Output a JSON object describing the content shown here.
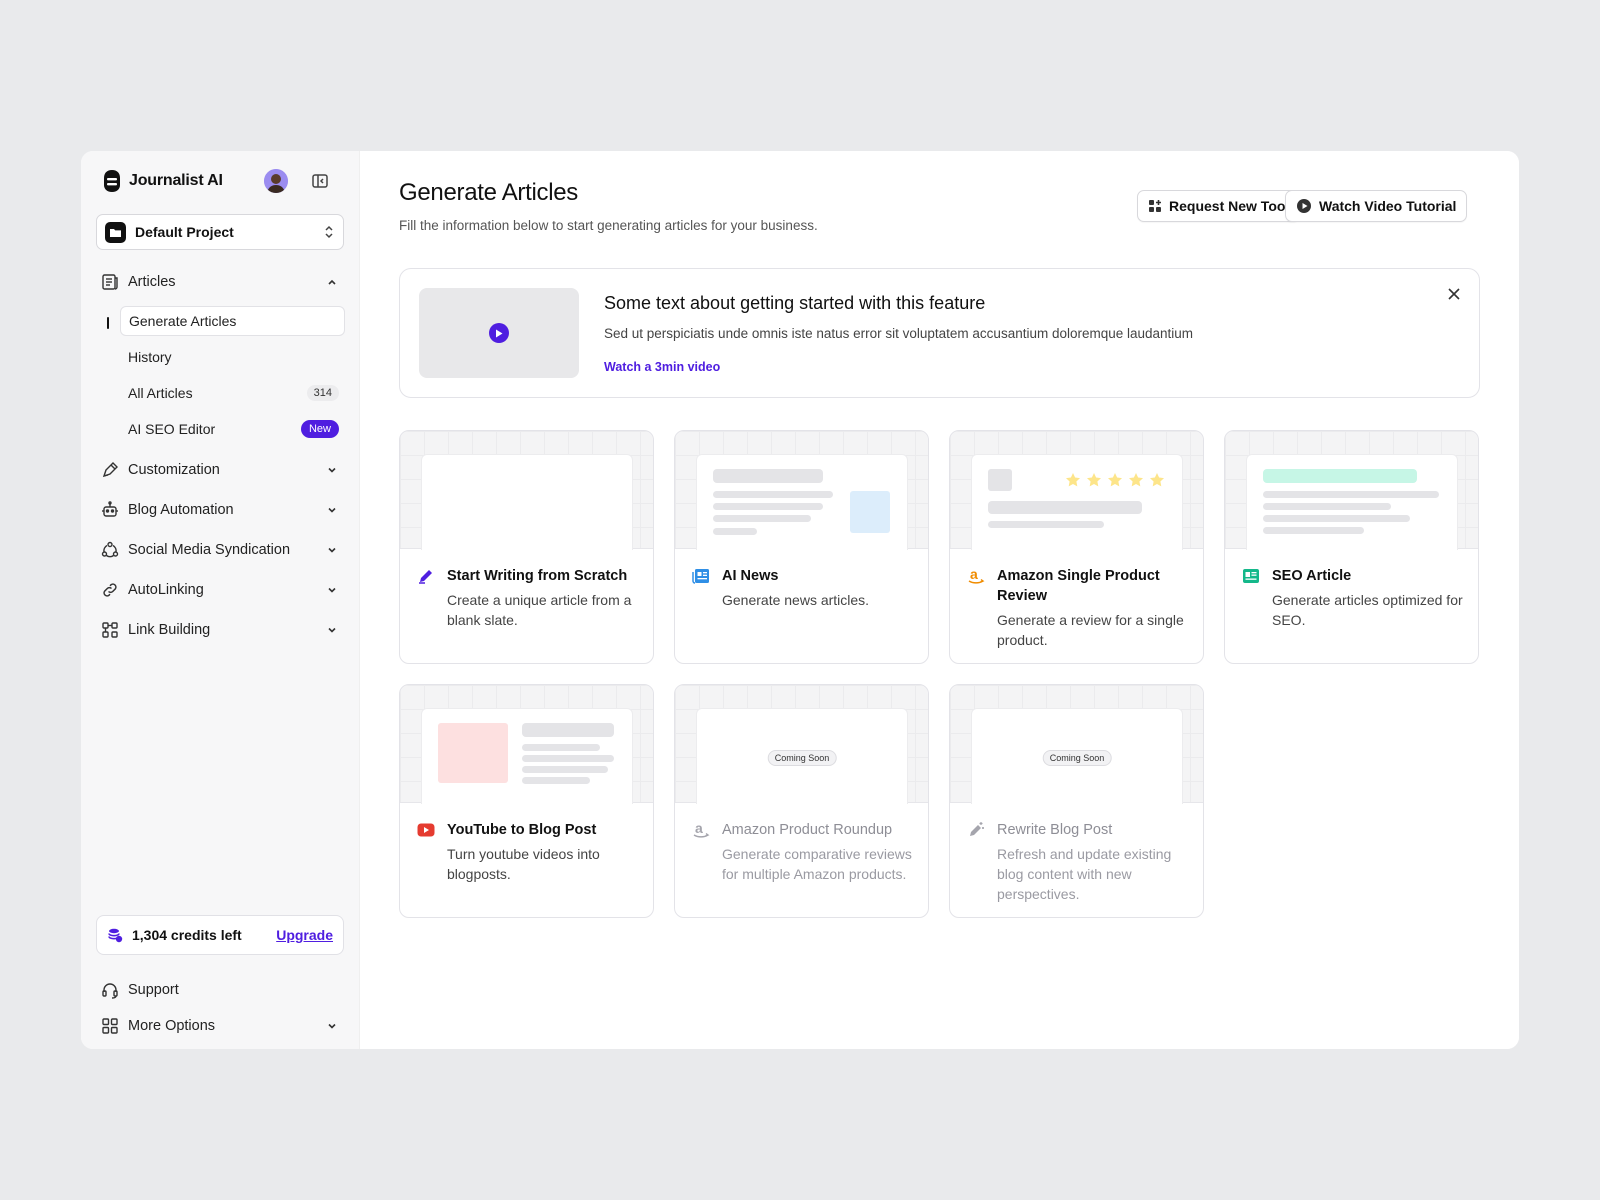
{
  "sidebar": {
    "brand": "Journalist AI",
    "project": "Default Project",
    "nav": [
      {
        "label": "Articles"
      },
      {
        "label": "Customization"
      },
      {
        "label": "Blog Automation"
      },
      {
        "label": "Social Media Syndication"
      },
      {
        "label": "AutoLinking"
      },
      {
        "label": "Link Building"
      }
    ],
    "articles_sub": [
      {
        "label": "Generate Articles"
      },
      {
        "label": "History"
      },
      {
        "label": "All Articles",
        "count": "314"
      },
      {
        "label": "AI SEO Editor",
        "badge": "New"
      }
    ],
    "credits": {
      "text": "1,304 credits left",
      "upgrade": "Upgrade"
    },
    "support": "Support",
    "more": "More Options"
  },
  "main": {
    "title": "Generate Articles",
    "subtitle": "Fill the information below to start generating articles for your business.",
    "buttons": {
      "request": "Request New Tool",
      "tutorial": "Watch Video Tutorial"
    },
    "banner": {
      "title": "Some text about getting started with this feature",
      "desc": "Sed ut perspiciatis unde omnis iste natus error sit voluptatem accusantium doloremque laudantium",
      "link": "Watch a 3min video"
    },
    "cards": [
      {
        "title": "Start Writing from Scratch",
        "desc": "Create a unique article from a blank slate.",
        "icon": "pen-icon"
      },
      {
        "title": "AI News",
        "desc": "Generate news articles.",
        "icon": "newspaper-icon"
      },
      {
        "title": "Amazon Single Product Review",
        "desc": "Generate a review for a single product.",
        "icon": "amazon-icon"
      },
      {
        "title": "SEO Article",
        "desc": "Generate articles optimized for SEO.",
        "icon": "article-icon"
      },
      {
        "title": "YouTube to Blog Post",
        "desc": "Turn youtube videos into blogposts.",
        "icon": "youtube-icon"
      },
      {
        "title": "Amazon Product Roundup",
        "desc": "Generate comparative reviews for multiple Amazon products.",
        "icon": "amazon-icon",
        "soon": "Coming Soon"
      },
      {
        "title": "Rewrite Blog Post",
        "desc": "Refresh and update existing blog content with new perspectives.",
        "icon": "magic-pen-icon",
        "soon": "Coming Soon"
      }
    ]
  },
  "colors": {
    "accent": "#4f1ee0",
    "background": "#e9eaec"
  }
}
